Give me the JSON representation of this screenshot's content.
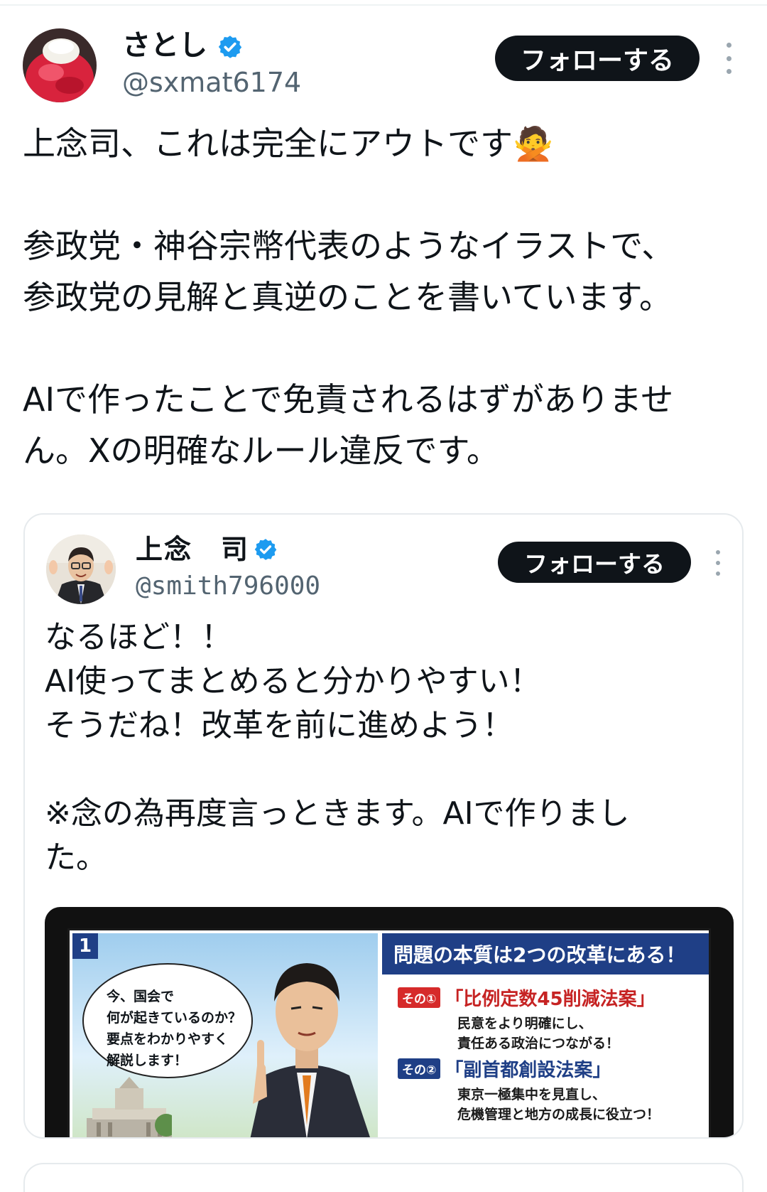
{
  "post": {
    "display_name": "さとし",
    "handle": "@sxmat6174",
    "follow_label": "フォローする",
    "text": "上念司、これは完全にアウトです🙅\n\n参政党・神谷宗幣代表のようなイラストで、\n参政党の見解と真逆のことを書いています。\n\nAIで作ったことで免責されるはずがありませ\nん。Xの明確なルール違反です。"
  },
  "quoted": {
    "display_name": "上念　司",
    "handle": "@smith796000",
    "follow_label": "フォローする",
    "text": "なるほど！！\nAI使ってまとめると分かりやすい！\nそうだね！改革を前に進めよう！\n\n※念の為再度言っときます。AIで作りまし\nた。",
    "image": {
      "panel_number": "1",
      "bubble_text": "今、国会で\n何が起きているのか？\n要点をわかりやすく\n解説します！",
      "heading": "問題の本質は2つの改革にある！",
      "items": [
        {
          "tag": "その①",
          "title": "「比例定数45削減法案」",
          "desc": "民意をより明確にし、\n責任ある政治につながる！"
        },
        {
          "tag": "その②",
          "title": "「副首都創設法案」",
          "desc": "東京一極集中を見直し、\n危機管理と地方の成長に役立つ！"
        }
      ]
    }
  },
  "colors": {
    "verified": "#1d9bf0",
    "button_bg": "#0f1419",
    "muted": "#536471",
    "infographic_navy": "#1f3f86",
    "infographic_red": "#c62323"
  },
  "icons": [
    "verified-badge-icon",
    "more-options-icon"
  ]
}
